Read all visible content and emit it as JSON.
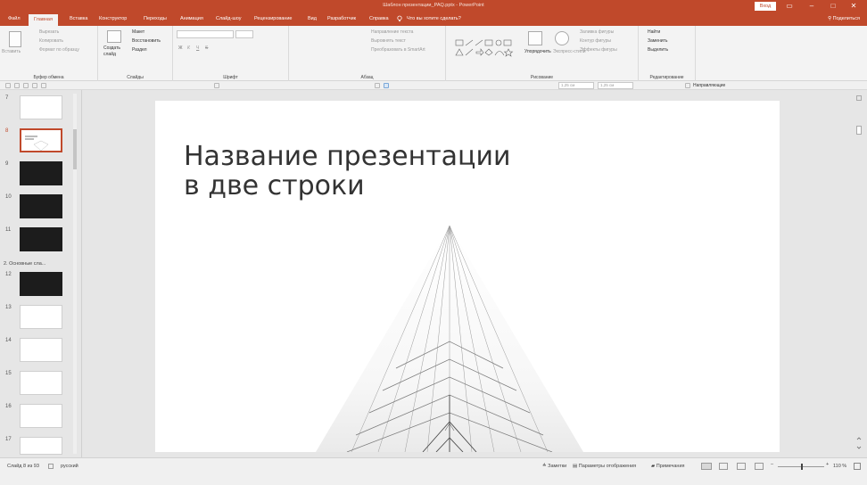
{
  "window": {
    "title": "Шаблон презентации_PAQ.pptx - PowerPoint",
    "signin_label": "Вход",
    "controls": [
      "▭",
      "–",
      "□",
      "✕"
    ]
  },
  "ribbon_tabs": [
    "Файл",
    "Главная",
    "Вставка",
    "Конструктор",
    "Переходы",
    "Анимация",
    "Слайд-шоу",
    "Рецензирование",
    "Вид",
    "Разработчик",
    "Справка"
  ],
  "active_tab": "Главная",
  "tell_me": "Что вы хотите сделать?",
  "share_label": "Поделиться",
  "ribbon": {
    "clipboard": {
      "paste": "Вставить",
      "cut": "Вырезать",
      "copy": "Копировать",
      "format_painter": "Формат по образцу",
      "group": "Буфер обмена"
    },
    "slides": {
      "new_slide": "Создать слайд",
      "layout": "Макет",
      "reset": "Восстановить",
      "section": "Раздел",
      "group": "Слайды"
    },
    "font": {
      "bold": "Ж",
      "italic": "К",
      "underline": "Ч",
      "strike": "S",
      "group": "Шрифт"
    },
    "paragraph": {
      "text_direction": "Направление текста",
      "align_text": "Выровнять текст",
      "convert_smartart": "Преобразовать в SmartArt",
      "group": "Абзац"
    },
    "drawing": {
      "arrange": "Упорядочить",
      "quick_styles": "Экспресс-стили",
      "fill": "Заливка фигуры",
      "outline": "Контур фигуры",
      "effects": "Эффекты фигуры",
      "group": "Рисование"
    },
    "editing": {
      "find": "Найти",
      "replace": "Заменить",
      "select": "Выделить",
      "group": "Редактирование"
    }
  },
  "quickbar": {
    "width1": "1,25 см",
    "height1": "1,25 см",
    "guides": "Направляющие"
  },
  "thumbnails": [
    {
      "num": "7",
      "style": "light"
    },
    {
      "num": "8",
      "style": "light",
      "selected": true
    },
    {
      "num": "9",
      "style": "dark"
    },
    {
      "num": "10",
      "style": "dark"
    },
    {
      "num": "11",
      "style": "dark"
    },
    {
      "num": "12",
      "style": "dark"
    },
    {
      "num": "13",
      "style": "light"
    },
    {
      "num": "14",
      "style": "light"
    },
    {
      "num": "15",
      "style": "light"
    },
    {
      "num": "16",
      "style": "light"
    },
    {
      "num": "17",
      "style": "light"
    }
  ],
  "section_label": "2. Основные сла...",
  "slide": {
    "title": "Название презентации\nв две строки"
  },
  "status": {
    "slide_info": "Слайд 8 из 93",
    "language": "русский",
    "notes": "Заметки",
    "display_settings": "Параметры отображения",
    "comments": "Примечания",
    "zoom": "110 %"
  },
  "colors": {
    "accent": "#c0492b",
    "ribbon": "#f3f3f3",
    "pane": "#e6e6e6"
  }
}
